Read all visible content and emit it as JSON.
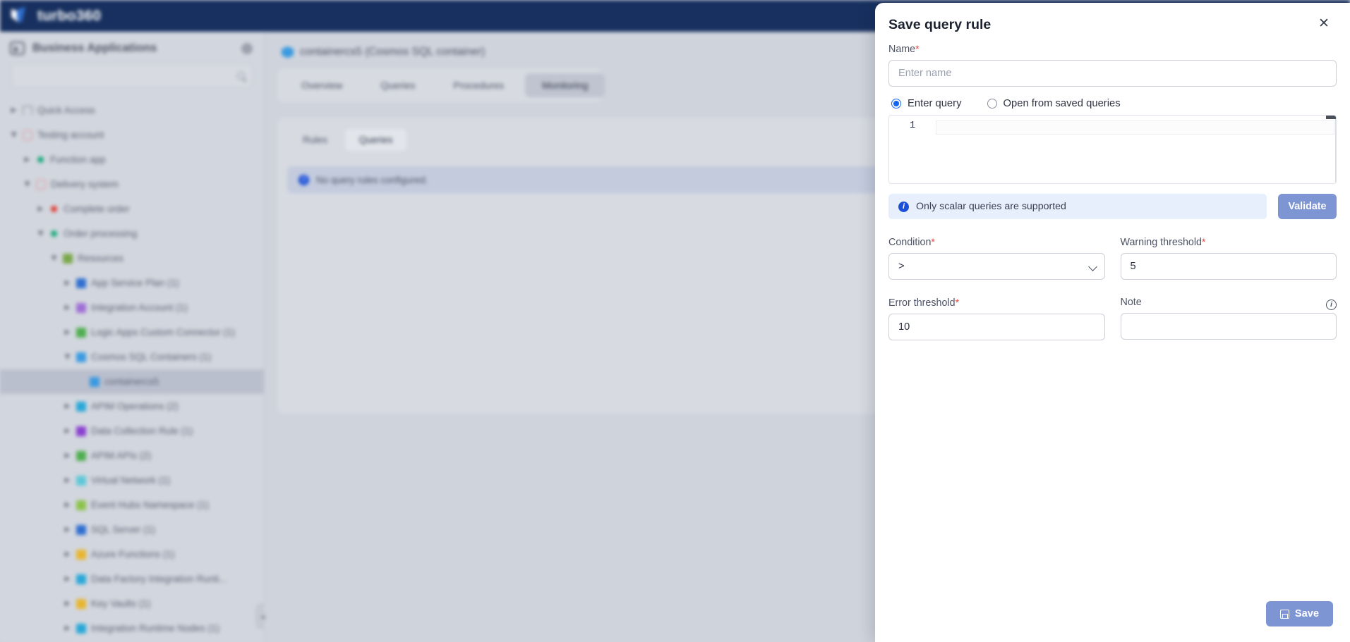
{
  "topbar": {
    "brand": "turbo360",
    "logo_icon": "turbo360-logo-icon"
  },
  "sidebar": {
    "title": "Business Applications",
    "gear_icon": "gear-icon",
    "search": {
      "placeholder": "",
      "value": "",
      "icon": "search-icon"
    },
    "collapse_icon": "chevron-left-icon",
    "items": [
      {
        "label": "Quick Access",
        "depth": 0,
        "caret": "right",
        "icon": "bookmark-icon",
        "color": "#7b8090"
      },
      {
        "label": "Testing account",
        "depth": 0,
        "caret": "down",
        "icon": "folder-icon",
        "color": "#e08a8a"
      },
      {
        "label": "Function app",
        "depth": 1,
        "caret": "right",
        "icon": "status-dot",
        "color": "#14a878"
      },
      {
        "label": "Delivery system",
        "depth": 1,
        "caret": "down",
        "icon": "folder-icon",
        "color": "#e08a8a"
      },
      {
        "label": "Complete order",
        "depth": 2,
        "caret": "right",
        "icon": "status-dot",
        "color": "#e03c31"
      },
      {
        "label": "Order processing",
        "depth": 2,
        "caret": "down",
        "icon": "status-dot",
        "color": "#14a878"
      },
      {
        "label": "Resources",
        "depth": 3,
        "caret": "down",
        "icon": "square-icon",
        "color": "#79a84a"
      },
      {
        "label": "App Service Plan (1)",
        "depth": 4,
        "caret": "right",
        "icon": "app-service-plan-icon",
        "color": "#2f6fd0"
      },
      {
        "label": "Integration Account (1)",
        "depth": 4,
        "caret": "right",
        "icon": "integration-account-icon",
        "color": "#a06fd6"
      },
      {
        "label": "Logic Apps Custom Connector (1)",
        "depth": 4,
        "caret": "right",
        "icon": "logic-apps-connector-icon",
        "color": "#4fae4f"
      },
      {
        "label": "Cosmos SQL Containers (1)",
        "depth": 4,
        "caret": "down",
        "icon": "cosmos-container-icon",
        "color": "#3b9ae1"
      },
      {
        "label": "containercs5",
        "depth": 5,
        "caret": "none",
        "icon": "cosmos-container-icon",
        "color": "#3b9ae1",
        "selected": true
      },
      {
        "label": "APIM Operations (2)",
        "depth": 4,
        "caret": "right",
        "icon": "apim-operations-icon",
        "color": "#28a8d8"
      },
      {
        "label": "Data Collection Rule (1)",
        "depth": 4,
        "caret": "right",
        "icon": "data-collection-rule-icon",
        "color": "#8a3fd1"
      },
      {
        "label": "APIM APIs (2)",
        "depth": 4,
        "caret": "right",
        "icon": "apim-apis-icon",
        "color": "#4fae4f"
      },
      {
        "label": "Virtual Network (1)",
        "depth": 4,
        "caret": "right",
        "icon": "virtual-network-icon",
        "color": "#5ec8d8"
      },
      {
        "label": "Event Hubs Namespace (1)",
        "depth": 4,
        "caret": "right",
        "icon": "event-hubs-icon",
        "color": "#8bc34a"
      },
      {
        "label": "SQL Server (1)",
        "depth": 4,
        "caret": "right",
        "icon": "sql-server-icon",
        "color": "#2f6fd0"
      },
      {
        "label": "Azure Functions (1)",
        "depth": 4,
        "caret": "right",
        "icon": "azure-functions-icon",
        "color": "#e8b52c"
      },
      {
        "label": "Data Factory Integration Runti...",
        "depth": 4,
        "caret": "right",
        "icon": "data-factory-icon",
        "color": "#28a8d8"
      },
      {
        "label": "Key Vaults (1)",
        "depth": 4,
        "caret": "right",
        "icon": "key-vault-icon",
        "color": "#e8b52c"
      },
      {
        "label": "Integration Runtime Nodes (1)",
        "depth": 4,
        "caret": "right",
        "icon": "integration-runtime-icon",
        "color": "#28a8d8"
      }
    ]
  },
  "content": {
    "breadcrumb": "containercs5 (Cosmos SQL container)",
    "breadcrumb_icon": "cosmos-container-icon",
    "main_tabs": [
      {
        "label": "Overview",
        "active": false
      },
      {
        "label": "Queries",
        "active": false
      },
      {
        "label": "Procedures",
        "active": false
      },
      {
        "label": "Monitoring",
        "active": true
      }
    ],
    "sub_tabs": [
      {
        "label": "Rules",
        "active": false
      },
      {
        "label": "Queries",
        "active": true
      }
    ],
    "empty_state": {
      "icon": "info-icon",
      "text": "No query rules configured."
    }
  },
  "drawer": {
    "title": "Save query rule",
    "close_icon": "close-icon",
    "name": {
      "label": "Name",
      "required": true,
      "placeholder": "Enter name",
      "value": ""
    },
    "query_source": {
      "options": [
        {
          "label": "Enter query",
          "checked": true
        },
        {
          "label": "Open from saved queries",
          "checked": false
        }
      ]
    },
    "editor": {
      "line_number": "1",
      "value": ""
    },
    "scalar_note": {
      "icon": "info-icon",
      "text": "Only scalar queries are supported"
    },
    "validate_label": "Validate",
    "condition": {
      "label": "Condition",
      "required": true,
      "value": ">",
      "options": [
        ">",
        "<",
        ">=",
        "<=",
        "=",
        "!="
      ],
      "chevron_icon": "chevron-down-icon"
    },
    "warning_threshold": {
      "label": "Warning threshold",
      "required": true,
      "value": "5"
    },
    "error_threshold": {
      "label": "Error threshold",
      "required": true,
      "value": "10"
    },
    "note": {
      "label": "Note",
      "required": false,
      "value": "",
      "placeholder": "",
      "info_icon": "info-outline-icon"
    },
    "save_label": "Save",
    "save_icon": "save-floppy-icon"
  },
  "colors": {
    "brand_navy": "#17305f",
    "accent_blue": "#7e95d4",
    "required_red": "#e8443a",
    "info_blue": "#1b4fd8",
    "radio_blue": "#1565f0"
  }
}
